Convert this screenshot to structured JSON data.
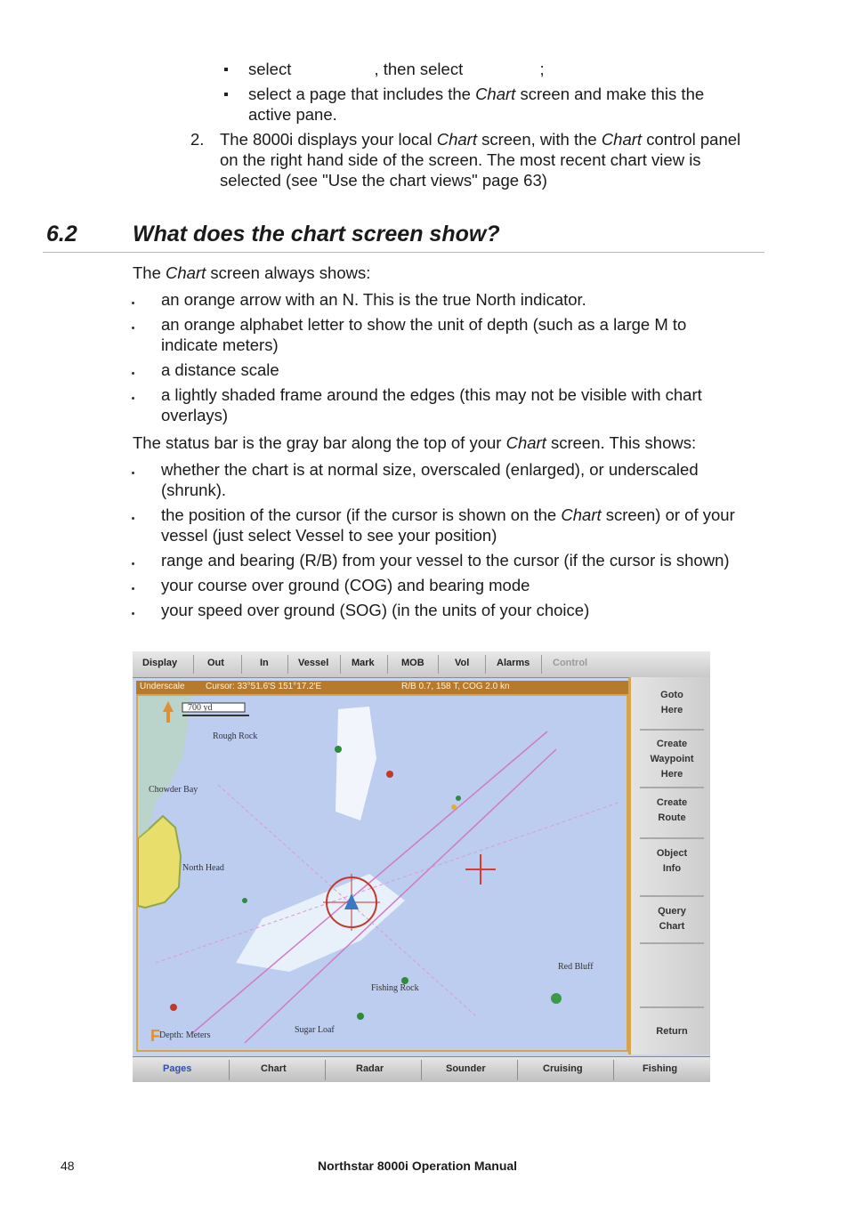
{
  "intro_bullets": [
    {
      "parts": [
        "select",
        " , then select ",
        " ;"
      ]
    },
    {
      "text_before": "select a page that includes the ",
      "em": "Chart",
      "text_after": " screen and make this the active pane."
    }
  ],
  "step2": {
    "number": "2.",
    "line1_before": "The 8000i displays your local ",
    "line1_em1": "Chart",
    "line1_mid": " screen, with the ",
    "line1_em2": "Chart",
    "line1_after": " control panel",
    "line2": "on the right hand side of the screen. The most recent chart view is",
    "line3": "selected (see \"Use the chart views\" page 63)"
  },
  "section": {
    "number": "6.2",
    "title": "What does the chart screen show?"
  },
  "always_shows": {
    "lead_before": "The ",
    "lead_em": "Chart",
    "lead_after": " screen always shows:",
    "items": [
      [
        "an orange arrow with an N. This is the true North indicator."
      ],
      [
        "an orange alphabet letter to show the unit of depth (such as a large M to",
        "indicate meters)"
      ],
      [
        "a distance scale"
      ],
      [
        "a lightly shaded frame around the edges (this may not be visible with chart",
        "overlays)"
      ]
    ]
  },
  "status_bar": {
    "lead_before": "The status bar is the gray bar along the top of your ",
    "lead_em": "Chart",
    "lead_after": " screen. This shows:",
    "item1": [
      "whether the chart is at normal size, overscaled (enlarged), or underscaled",
      "(shrunk)."
    ],
    "item2_l1_before": "the position of the cursor (if the cursor is shown on the ",
    "item2_l1_em": "Chart",
    "item2_l1_after": " screen) or of your",
    "item2_l2": "vessel (just select Vessel to see your position)",
    "item3": "range and bearing (R/B) from your vessel to the cursor (if the cursor is shown)",
    "item4": "your course over ground (COG) and bearing mode",
    "item5": "your speed over ground (SOG) (in the units of your choice)"
  },
  "screenshot": {
    "top_menu": [
      "Display",
      "Out",
      "In",
      "Vessel",
      "Mark",
      "MOB",
      "Vol",
      "Alarms",
      "Control"
    ],
    "status_text": [
      "Underscale",
      "Cursor: 33°51.6'S 151°17.2'E",
      "R/B 0.7, 158 T, COG 2.0 kn"
    ],
    "scale_label": "700 yd",
    "map_labels": [
      "Rough Rock",
      "Chowder Bay",
      "North Head",
      "Fishing Rock",
      "Red Bluff",
      "Depth: Meters",
      "Sugar Loaf"
    ],
    "side_buttons": [
      [
        "Goto",
        "Here"
      ],
      [
        "Create",
        "Waypoint",
        "Here"
      ],
      [
        "Create",
        "Route"
      ],
      [
        "Object",
        "Info"
      ],
      [
        "Query",
        "Chart"
      ],
      [
        "Return"
      ]
    ],
    "bottom_tabs": [
      "Pages",
      "Chart",
      "Radar",
      "Sounder",
      "Cruising",
      "Fishing"
    ]
  },
  "footer": {
    "page_number": "48",
    "manual_title": "Northstar 8000i Operation Manual"
  }
}
